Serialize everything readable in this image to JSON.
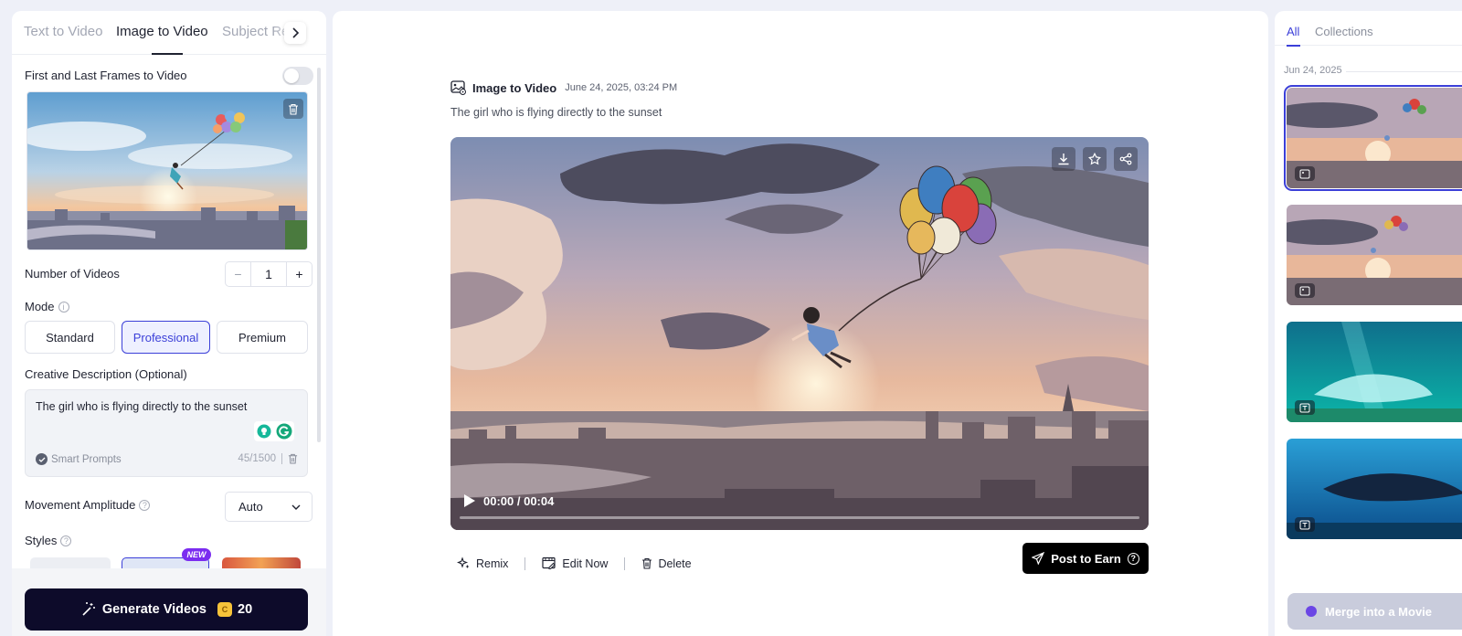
{
  "left_panel": {
    "tabs": [
      {
        "label": "Text to Video",
        "active": false
      },
      {
        "label": "Image to Video",
        "active": true
      },
      {
        "label": "Subject Re",
        "active": false
      }
    ],
    "frames_toggle_label": "First and Last Frames to Video",
    "frames_toggle_on": false,
    "num_videos_label": "Number of Videos",
    "num_videos_value": "1",
    "stepper_minus": "−",
    "stepper_plus": "+",
    "mode_label": "Mode",
    "modes": [
      {
        "label": "Standard",
        "selected": false
      },
      {
        "label": "Professional",
        "selected": true
      },
      {
        "label": "Premium",
        "selected": false
      }
    ],
    "desc_label": "Creative Description (Optional)",
    "desc_text": "The girl who is flying directly to the sunset",
    "smart_prompts": "Smart Prompts",
    "char_count": "45/1500",
    "movement_label": "Movement Amplitude",
    "movement_value": "Auto",
    "styles_label": "Styles",
    "new_badge": "NEW",
    "generate_label": "Generate Videos",
    "generate_cost": "20"
  },
  "main": {
    "title": "Image to Video",
    "date": "June 24, 2025, 03:24 PM",
    "prompt": "The girl who is flying directly to the sunset",
    "time": "00:00 / 00:04",
    "actions": [
      "Remix",
      "Edit Now",
      "Delete"
    ],
    "post_label": "Post to Earn"
  },
  "right_panel": {
    "tabs": [
      {
        "label": "All",
        "active": true
      },
      {
        "label": "Collections",
        "active": false
      }
    ],
    "date_group": "Jun 24, 2025",
    "merge_label": "Merge into a Movie"
  },
  "colors": {
    "accent": "#3b3fd8",
    "generate_bg": "#0d0b2a",
    "post_bg": "#000000",
    "coin": "#f6c33a"
  }
}
